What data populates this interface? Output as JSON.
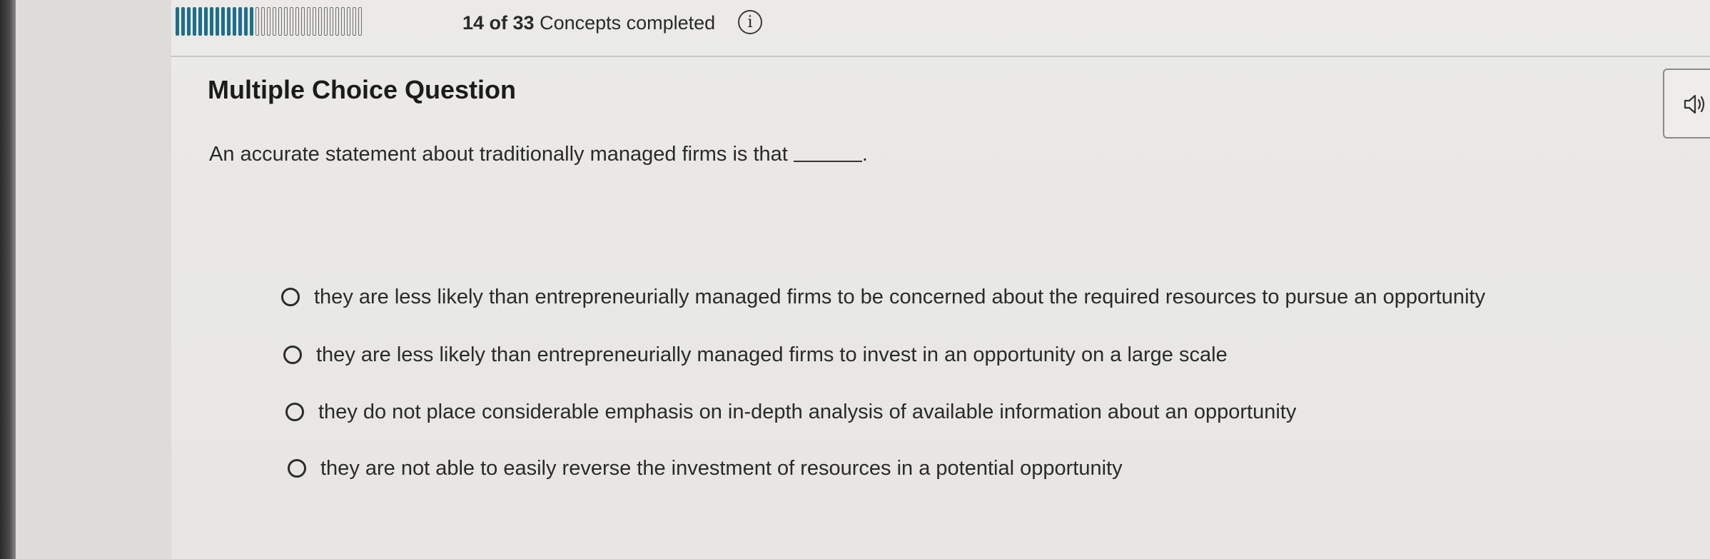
{
  "progress": {
    "completed": 14,
    "total": 33,
    "count_text": "14 of 33",
    "suffix_text": " Concepts completed",
    "colors": {
      "done": "#1d6f8c",
      "todo": "#707070"
    }
  },
  "header": {
    "info_icon": "info-icon",
    "info_glyph": "i"
  },
  "audio": {
    "icon": "speaker-icon"
  },
  "question": {
    "type_label": "Multiple Choice Question",
    "prompt": "An accurate statement about traditionally managed firms is that",
    "prompt_end": "."
  },
  "options": [
    {
      "label": "they are less likely than entrepreneurially managed firms to be concerned about the required resources to pursue an opportunity",
      "selected": false
    },
    {
      "label": "they are less likely than entrepreneurially managed firms to invest in an opportunity on a large scale",
      "selected": false
    },
    {
      "label": "they do not place considerable emphasis on in-depth analysis of available information about an opportunity",
      "selected": false
    },
    {
      "label": "they are not able to easily reverse the investment of resources in a potential opportunity",
      "selected": false
    }
  ]
}
